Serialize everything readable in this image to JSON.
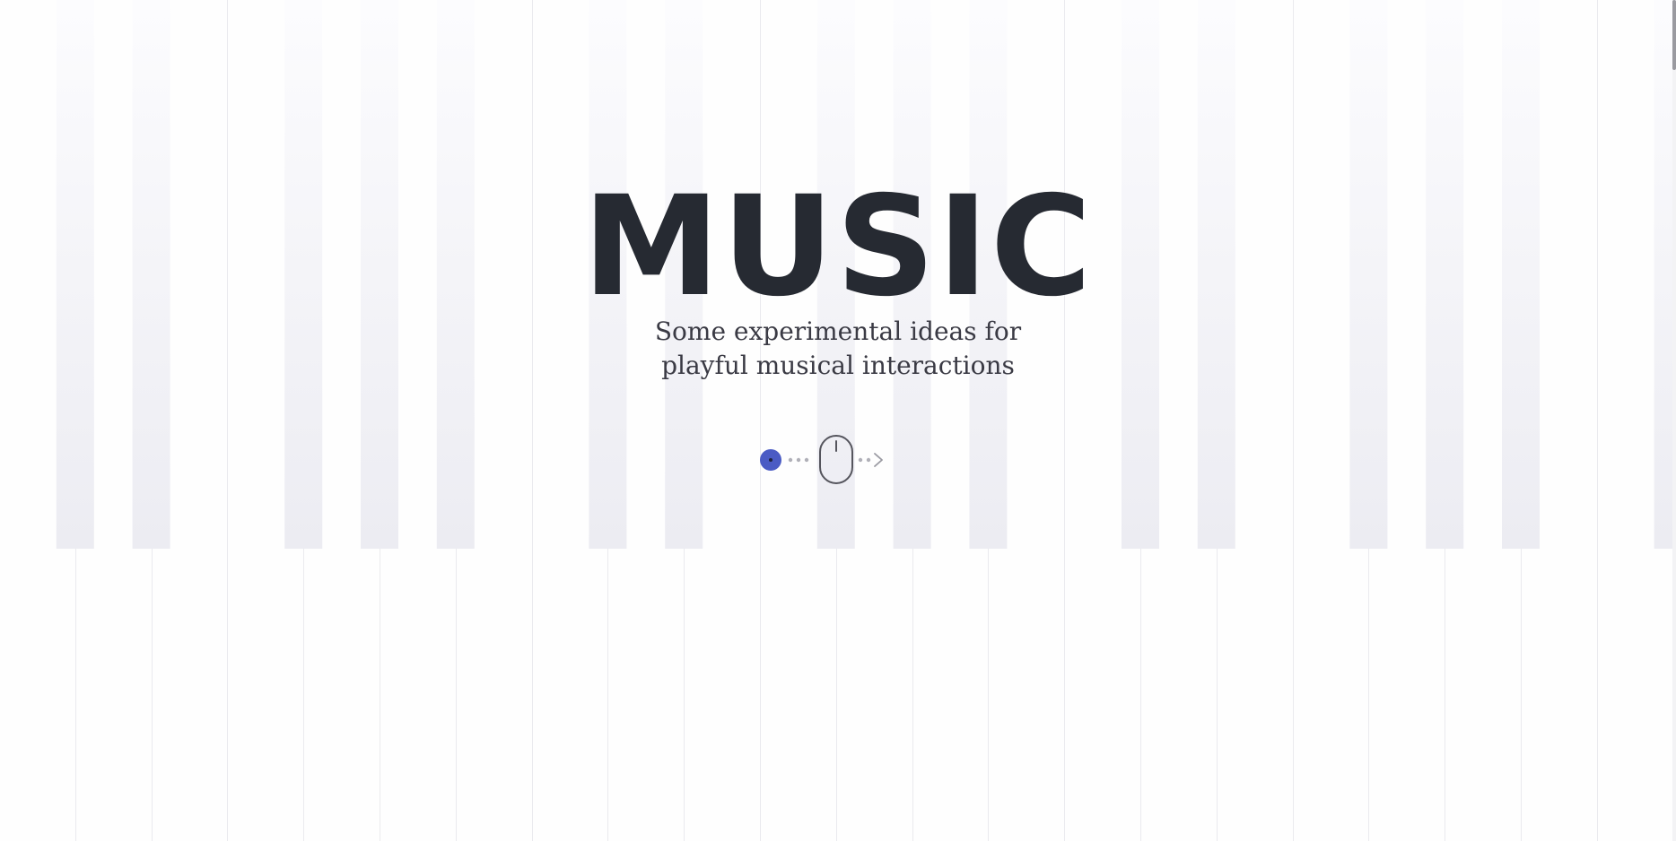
{
  "hero": {
    "title": "MUSIC",
    "subtitle_line1": "Some experimental ideas for",
    "subtitle_line2": "playful musical interactions"
  },
  "colors": {
    "title": "#262a32",
    "subtitle": "#3a3a44",
    "accent": "#4a5bc4",
    "black_key_top": "#fbfbfd",
    "black_key_bottom": "#ededf3",
    "key_line": "#eaeaee"
  },
  "icons": {
    "start_dot": "filled-circle-icon",
    "mouse": "mouse-icon",
    "arrow": "chevron-right-icon"
  }
}
